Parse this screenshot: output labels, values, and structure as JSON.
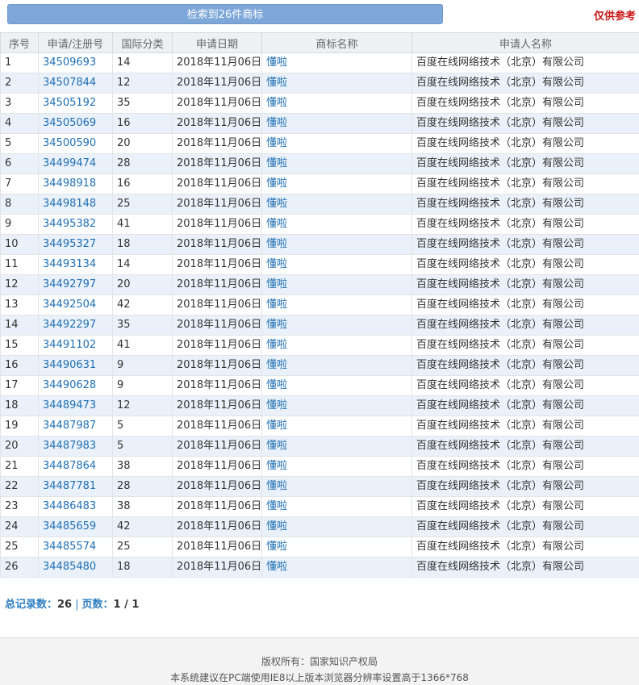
{
  "header": {
    "search_result": "检索到26件商标",
    "disclaimer": "仅供参考"
  },
  "table": {
    "columns": [
      "序号",
      "申请/注册号",
      "国际分类",
      "申请日期",
      "商标名称",
      "申请人名称"
    ],
    "rows": [
      {
        "no": "1",
        "reg": "34509693",
        "cls": "14",
        "date": "2018年11月06日",
        "name": "懂啦",
        "applicant": "百度在线网络技术（北京）有限公司"
      },
      {
        "no": "2",
        "reg": "34507844",
        "cls": "12",
        "date": "2018年11月06日",
        "name": "懂啦",
        "applicant": "百度在线网络技术（北京）有限公司"
      },
      {
        "no": "3",
        "reg": "34505192",
        "cls": "35",
        "date": "2018年11月06日",
        "name": "懂啦",
        "applicant": "百度在线网络技术（北京）有限公司"
      },
      {
        "no": "4",
        "reg": "34505069",
        "cls": "16",
        "date": "2018年11月06日",
        "name": "懂啦",
        "applicant": "百度在线网络技术（北京）有限公司"
      },
      {
        "no": "5",
        "reg": "34500590",
        "cls": "20",
        "date": "2018年11月06日",
        "name": "懂啦",
        "applicant": "百度在线网络技术（北京）有限公司"
      },
      {
        "no": "6",
        "reg": "34499474",
        "cls": "28",
        "date": "2018年11月06日",
        "name": "懂啦",
        "applicant": "百度在线网络技术（北京）有限公司"
      },
      {
        "no": "7",
        "reg": "34498918",
        "cls": "16",
        "date": "2018年11月06日",
        "name": "懂啦",
        "applicant": "百度在线网络技术（北京）有限公司"
      },
      {
        "no": "8",
        "reg": "34498148",
        "cls": "25",
        "date": "2018年11月06日",
        "name": "懂啦",
        "applicant": "百度在线网络技术（北京）有限公司"
      },
      {
        "no": "9",
        "reg": "34495382",
        "cls": "41",
        "date": "2018年11月06日",
        "name": "懂啦",
        "applicant": "百度在线网络技术（北京）有限公司"
      },
      {
        "no": "10",
        "reg": "34495327",
        "cls": "18",
        "date": "2018年11月06日",
        "name": "懂啦",
        "applicant": "百度在线网络技术（北京）有限公司"
      },
      {
        "no": "11",
        "reg": "34493134",
        "cls": "14",
        "date": "2018年11月06日",
        "name": "懂啦",
        "applicant": "百度在线网络技术（北京）有限公司"
      },
      {
        "no": "12",
        "reg": "34492797",
        "cls": "20",
        "date": "2018年11月06日",
        "name": "懂啦",
        "applicant": "百度在线网络技术（北京）有限公司"
      },
      {
        "no": "13",
        "reg": "34492504",
        "cls": "42",
        "date": "2018年11月06日",
        "name": "懂啦",
        "applicant": "百度在线网络技术（北京）有限公司"
      },
      {
        "no": "14",
        "reg": "34492297",
        "cls": "35",
        "date": "2018年11月06日",
        "name": "懂啦",
        "applicant": "百度在线网络技术（北京）有限公司"
      },
      {
        "no": "15",
        "reg": "34491102",
        "cls": "41",
        "date": "2018年11月06日",
        "name": "懂啦",
        "applicant": "百度在线网络技术（北京）有限公司"
      },
      {
        "no": "16",
        "reg": "34490631",
        "cls": "9",
        "date": "2018年11月06日",
        "name": "懂啦",
        "applicant": "百度在线网络技术（北京）有限公司"
      },
      {
        "no": "17",
        "reg": "34490628",
        "cls": "9",
        "date": "2018年11月06日",
        "name": "懂啦",
        "applicant": "百度在线网络技术（北京）有限公司"
      },
      {
        "no": "18",
        "reg": "34489473",
        "cls": "12",
        "date": "2018年11月06日",
        "name": "懂啦",
        "applicant": "百度在线网络技术（北京）有限公司"
      },
      {
        "no": "19",
        "reg": "34487987",
        "cls": "5",
        "date": "2018年11月06日",
        "name": "懂啦",
        "applicant": "百度在线网络技术（北京）有限公司"
      },
      {
        "no": "20",
        "reg": "34487983",
        "cls": "5",
        "date": "2018年11月06日",
        "name": "懂啦",
        "applicant": "百度在线网络技术（北京）有限公司"
      },
      {
        "no": "21",
        "reg": "34487864",
        "cls": "38",
        "date": "2018年11月06日",
        "name": "懂啦",
        "applicant": "百度在线网络技术（北京）有限公司"
      },
      {
        "no": "22",
        "reg": "34487781",
        "cls": "28",
        "date": "2018年11月06日",
        "name": "懂啦",
        "applicant": "百度在线网络技术（北京）有限公司"
      },
      {
        "no": "23",
        "reg": "34486483",
        "cls": "38",
        "date": "2018年11月06日",
        "name": "懂啦",
        "applicant": "百度在线网络技术（北京）有限公司"
      },
      {
        "no": "24",
        "reg": "34485659",
        "cls": "42",
        "date": "2018年11月06日",
        "name": "懂啦",
        "applicant": "百度在线网络技术（北京）有限公司"
      },
      {
        "no": "25",
        "reg": "34485574",
        "cls": "25",
        "date": "2018年11月06日",
        "name": "懂啦",
        "applicant": "百度在线网络技术（北京）有限公司"
      },
      {
        "no": "26",
        "reg": "34485480",
        "cls": "18",
        "date": "2018年11月06日",
        "name": "懂啦",
        "applicant": "百度在线网络技术（北京）有限公司"
      }
    ]
  },
  "summary": {
    "total_label": "总记录数：",
    "total_value": "26",
    "separator": "|",
    "pages_label": "页数：",
    "pages_value": "1 / 1"
  },
  "footer": {
    "copyright": "版权所有：国家知识产权局",
    "note": "本系统建议在PC端使用IE8以上版本浏览器分辨率设置高于1366*768"
  },
  "colors": {
    "banner": "#7da7d9",
    "disclaimer": "#c81818",
    "link": "#1f6fb3",
    "row_alt": "#eaf1fa",
    "header_bg": "#eef0f3"
  }
}
